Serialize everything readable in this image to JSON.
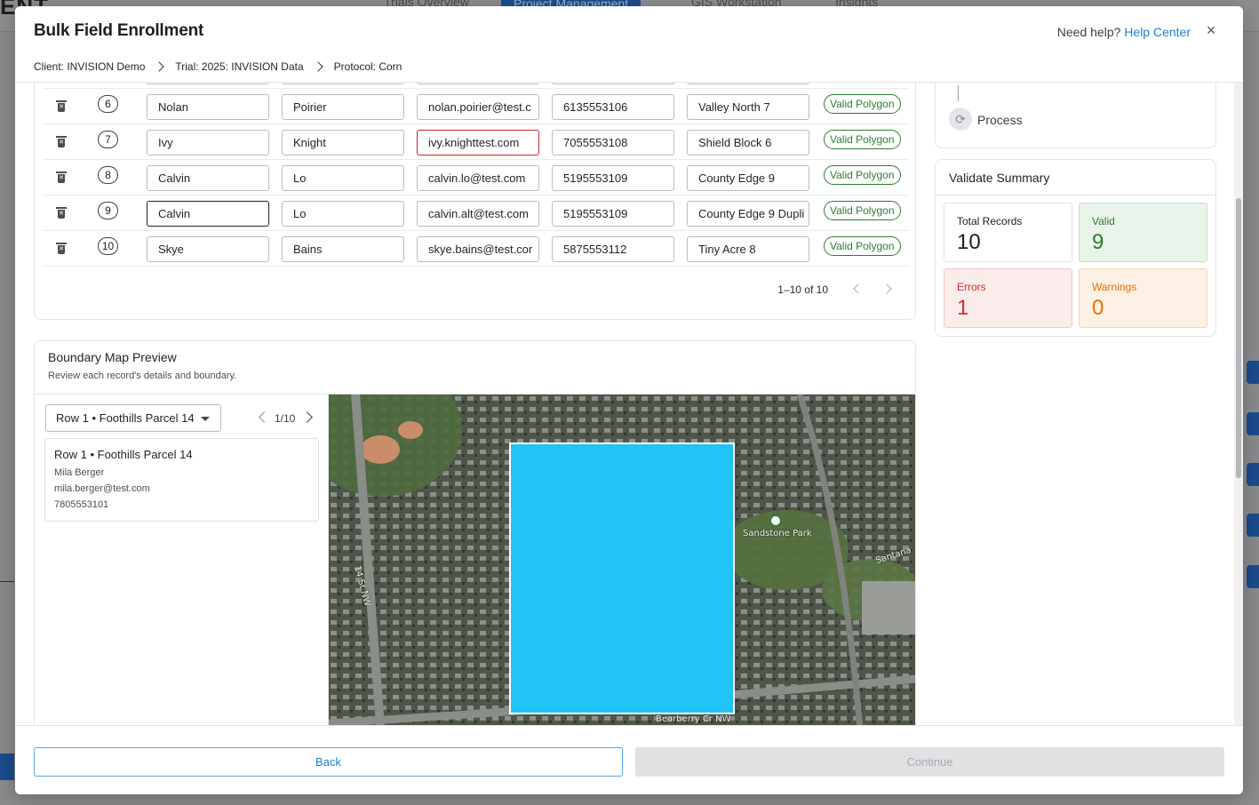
{
  "background": {
    "logo": "ENT",
    "tabs": [
      "Trials Overview",
      "Project Management",
      "GIS Workstation",
      "Insights"
    ]
  },
  "modal": {
    "title": "Bulk Field Enrollment",
    "help_prefix": "Need help?",
    "help_link": "Help Center",
    "close_label": "×",
    "breadcrumb": [
      "Client: INVISION Demo",
      "Trial: 2025: INVISION Data",
      "Protocol: Corn"
    ]
  },
  "table": {
    "rows": [
      {
        "num": "6",
        "first": "Nolan",
        "last": "Poirier",
        "email": "nolan.poirier@test.c",
        "phone": "6135553106",
        "field": "Valley North 7",
        "status": "Valid Polygon"
      },
      {
        "num": "7",
        "first": "Ivy",
        "last": "Knight",
        "email": "ivy.knighttest.com",
        "phone": "7055553108",
        "field": "Shield Block 6",
        "status": "Valid Polygon"
      },
      {
        "num": "8",
        "first": "Calvin",
        "last": "Lo",
        "email": "calvin.lo@test.com",
        "phone": "5195553109",
        "field": "County Edge 9",
        "status": "Valid Polygon"
      },
      {
        "num": "9",
        "first": "Calvin",
        "last": "Lo",
        "email": "calvin.alt@test.com",
        "phone": "5195553109",
        "field": "County Edge 9 Dupli",
        "status": "Valid Polygon"
      },
      {
        "num": "10",
        "first": "Skye",
        "last": "Bains",
        "email": "skye.bains@test.cor",
        "phone": "5875553112",
        "field": "Tiny Acre 8",
        "status": "Valid Polygon"
      }
    ],
    "pagination": "1–10 of 10"
  },
  "process": {
    "label": "Process"
  },
  "summary": {
    "title": "Validate Summary",
    "total_label": "Total Records",
    "total": "10",
    "valid_label": "Valid",
    "valid": "9",
    "errors_label": "Errors",
    "errors": "1",
    "warnings_label": "Warnings",
    "warnings": "0",
    "colors": {
      "valid": "#2e7d32",
      "errors": "#d32f2f",
      "warnings": "#ef6c00"
    }
  },
  "map_preview": {
    "title": "Boundary Map Preview",
    "subtitle": "Review each record's details and boundary.",
    "selected": "Row 1 • Foothills Parcel 14",
    "nav_count": "1/10",
    "detail": {
      "title": "Row 1 • Foothills Parcel 14",
      "name": "Mila Berger",
      "email": "mila.berger@test.com",
      "phone": "7805553101"
    },
    "labels": {
      "park": "Sandstone Park",
      "street1": "14 St NW",
      "street2": "Santana",
      "street3": "Bearberry Cr NW"
    },
    "boundary_color": "#22c3f5"
  },
  "footer": {
    "back": "Back",
    "continue": "Continue"
  }
}
